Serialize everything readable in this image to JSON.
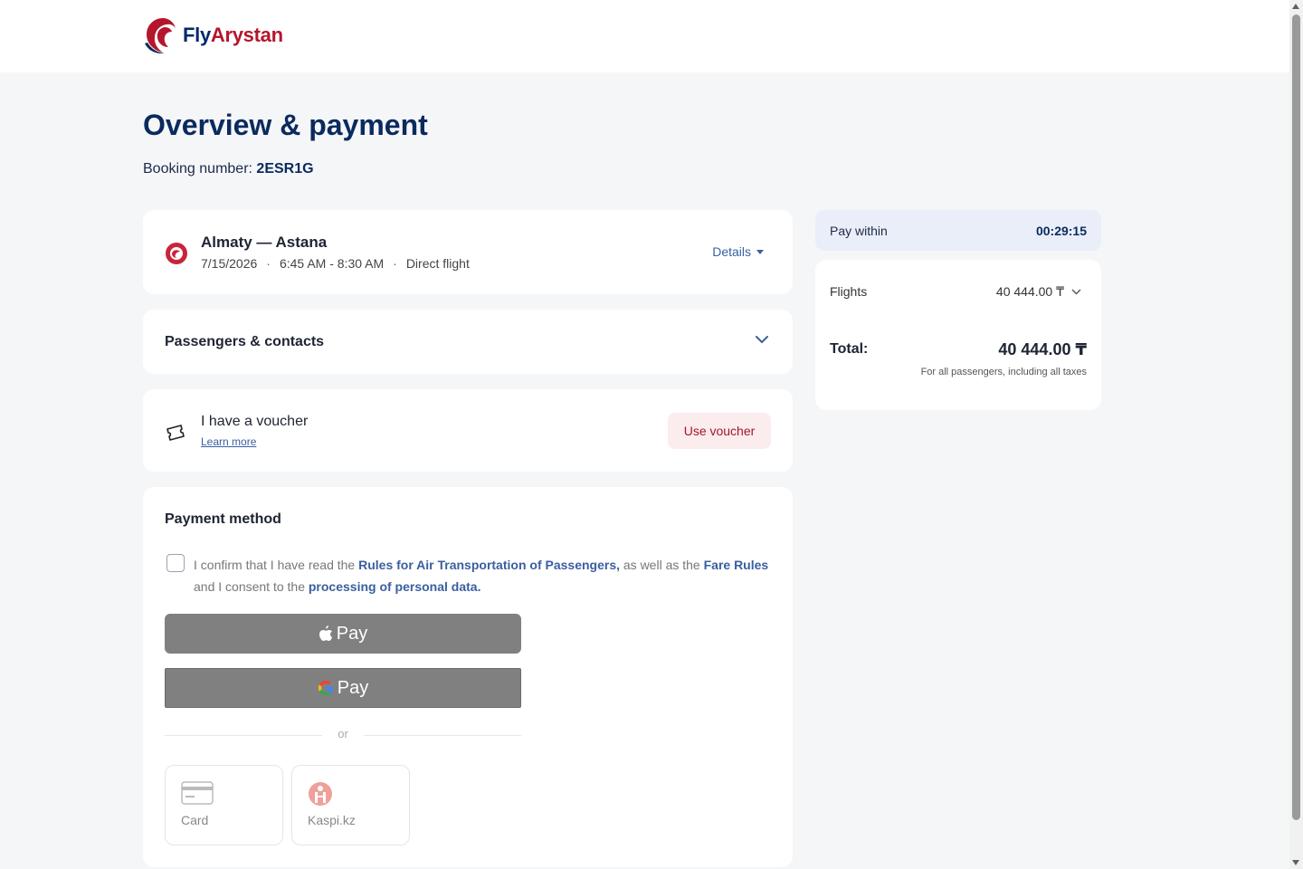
{
  "header": {
    "logo": {
      "part1": "Fly",
      "part2": "Arystan"
    }
  },
  "page": {
    "title": "Overview & payment",
    "booking_label": "Booking number:",
    "booking_number": "2ESR1G"
  },
  "flight": {
    "route": "Almaty — Astana",
    "date": "7/15/2026",
    "time": "6:45 AM - 8:30 AM",
    "type": "Direct flight",
    "details_label": "Details"
  },
  "passengers": {
    "title": "Passengers & contacts"
  },
  "voucher": {
    "title": "I have a voucher",
    "learn_more": "Learn more",
    "button": "Use voucher"
  },
  "payment": {
    "title": "Payment method",
    "consent": {
      "part1": "I confirm that I have read the ",
      "link1": "Rules for Air Transportation of Passengers,",
      "part2": " as well as the ",
      "link2": "Fare Rules",
      "part3": " and I consent to the ",
      "link3": "processing of personal data."
    },
    "apple_pay": "Pay",
    "google_pay": "Pay",
    "or": "or",
    "methods": [
      {
        "label": "Card"
      },
      {
        "label": "Kaspi.kz"
      }
    ]
  },
  "sidebar": {
    "timer_label": "Pay within",
    "timer_value": "00:29:15",
    "flights_label": "Flights",
    "flights_value": "40 444.00 ₸",
    "total_label": "Total:",
    "total_value": "40 444.00 ₸",
    "total_note": "For all passengers, including all taxes"
  },
  "colors": {
    "brand_navy": "#0b2a5e",
    "brand_red": "#b4162c",
    "link_blue": "#3a5fa0",
    "page_bg": "#f5f6f8"
  }
}
